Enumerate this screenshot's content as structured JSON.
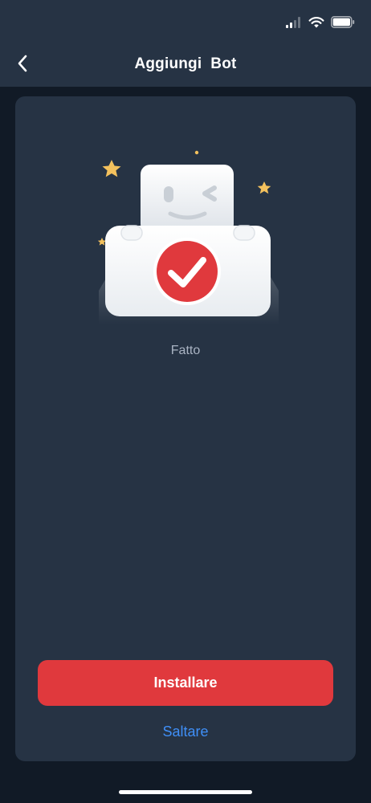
{
  "header": {
    "title": "Aggiungi  Bot",
    "back_icon": "chevron-left-icon"
  },
  "status_bar": {
    "icons": [
      "cellular-signal-icon",
      "wifi-icon",
      "battery-icon"
    ]
  },
  "main": {
    "illustration": "robot-success-illustration",
    "status_text": "Fatto",
    "install_label": "Installare",
    "skip_label": "Saltare"
  },
  "colors": {
    "background": "#111a26",
    "surface": "#263344",
    "accent_red": "#e0393d",
    "link_blue": "#3f8ff7",
    "muted_text": "#aab4c3"
  }
}
